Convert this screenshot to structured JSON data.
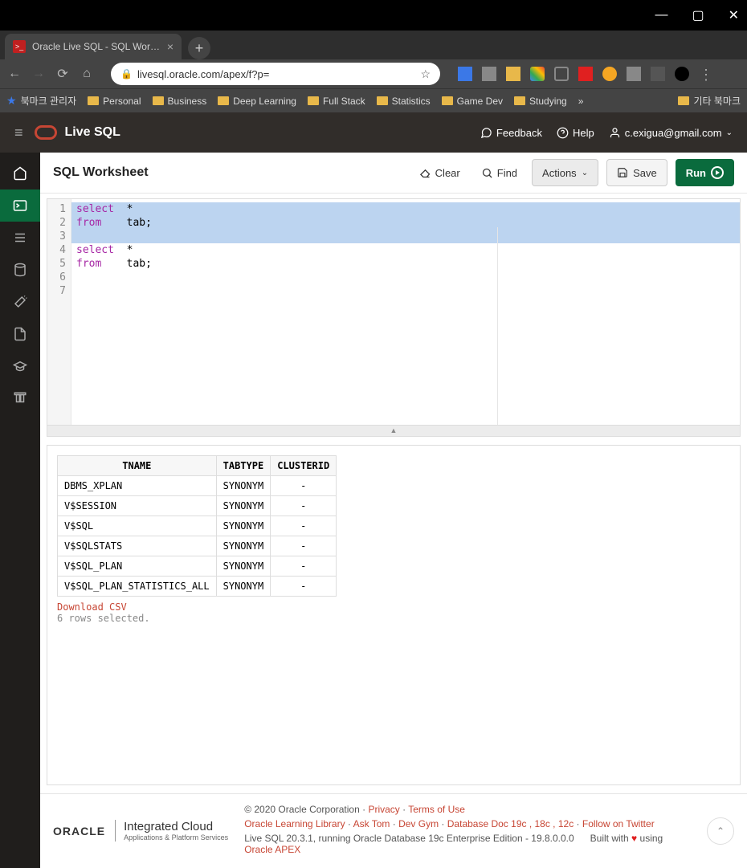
{
  "window": {
    "title": "Oracle Live SQL - SQL Workshe"
  },
  "browser": {
    "url": "livesql.oracle.com/apex/f?p=",
    "bookmarks": [
      "북마크 관리자",
      "Personal",
      "Business",
      "Deep Learning",
      "Full Stack",
      "Statistics",
      "Game Dev",
      "Studying"
    ],
    "bookmarks_overflow": "»",
    "bookmarks_right": "기타 북마크"
  },
  "header": {
    "app": "Live SQL",
    "feedback": "Feedback",
    "help": "Help",
    "user": "c.exigua@gmail.com"
  },
  "page": {
    "title": "SQL Worksheet",
    "clear": "Clear",
    "find": "Find",
    "actions": "Actions",
    "save": "Save",
    "run": "Run"
  },
  "editor": {
    "gutters": [
      "1",
      "2",
      "3",
      "4",
      "5",
      "6",
      "7"
    ],
    "lines": [
      {
        "sel": true,
        "tokens": [
          [
            "kw",
            "select"
          ],
          [
            "",
            "  *"
          ]
        ]
      },
      {
        "sel": true,
        "tokens": [
          [
            "kw",
            "from"
          ],
          [
            "",
            "    tab;"
          ]
        ]
      },
      {
        "sel": true,
        "tokens": []
      },
      {
        "sel": false,
        "tokens": [
          [
            "kw",
            "select"
          ],
          [
            "",
            "  *"
          ]
        ]
      },
      {
        "sel": false,
        "tokens": [
          [
            "kw",
            "from"
          ],
          [
            "",
            "    tab;"
          ]
        ]
      },
      {
        "sel": false,
        "tokens": []
      },
      {
        "sel": false,
        "tokens": []
      }
    ]
  },
  "results": {
    "headers": [
      "TNAME",
      "TABTYPE",
      "CLUSTERID"
    ],
    "rows": [
      [
        "DBMS_XPLAN",
        "SYNONYM",
        "-"
      ],
      [
        "V$SESSION",
        "SYNONYM",
        "-"
      ],
      [
        "V$SQL",
        "SYNONYM",
        "-"
      ],
      [
        "V$SQLSTATS",
        "SYNONYM",
        "-"
      ],
      [
        "V$SQL_PLAN",
        "SYNONYM",
        "-"
      ],
      [
        "V$SQL_PLAN_STATISTICS_ALL",
        "SYNONYM",
        "-"
      ]
    ],
    "download": "Download CSV",
    "message": "6 rows selected."
  },
  "footer": {
    "copyright": "© 2020 Oracle Corporation",
    "privacy": "Privacy",
    "terms": "Terms of Use",
    "links": [
      "Oracle Learning Library",
      "Ask Tom",
      "Dev Gym",
      "Database Doc 19c , 18c , 12c",
      "Follow on Twitter"
    ],
    "version": "Live SQL 20.3.1, running Oracle Database 19c Enterprise Edition - 19.8.0.0.0",
    "built": "Built with",
    "using": "using",
    "apex": "Oracle APEX",
    "oracle": "ORACLE",
    "cloud_big": "Integrated Cloud",
    "cloud_small": "Applications & Platform Services"
  }
}
